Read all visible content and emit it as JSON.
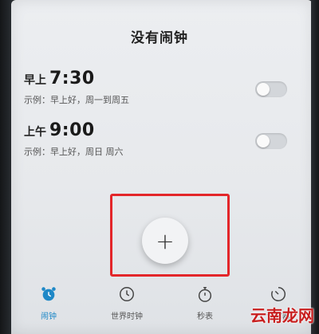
{
  "header": {
    "title": "没有闹钟"
  },
  "alarms": [
    {
      "period": "早上",
      "time": "7:30",
      "description": "示例：早上好，周一到周五",
      "enabled": false
    },
    {
      "period": "上午",
      "time": "9:00",
      "description": "示例：早上好，周日 周六",
      "enabled": false
    }
  ],
  "add_button": {
    "symbol": "+"
  },
  "tabs": [
    {
      "label": "闹钟",
      "icon": "alarm-clock-icon",
      "active": true
    },
    {
      "label": "世界时钟",
      "icon": "clock-icon",
      "active": false
    },
    {
      "label": "秒表",
      "icon": "stopwatch-icon",
      "active": false
    },
    {
      "label": "计时器",
      "icon": "timer-icon",
      "active": false
    }
  ],
  "watermark": "云南龙网",
  "colors": {
    "accent": "#1e88c7",
    "highlight": "#e3262a"
  }
}
